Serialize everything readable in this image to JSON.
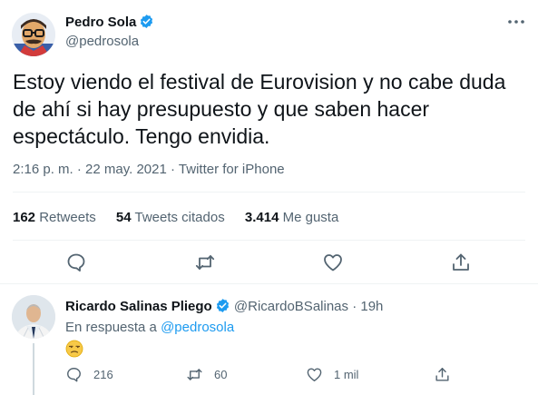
{
  "tweet": {
    "author_name": "Pedro Sola",
    "author_handle": "@pedrosola",
    "text": "Estoy viendo el festival de Eurovision y no cabe duda de ahí si hay presupuesto y que saben hacer espectáculo. Tengo envidia.",
    "time": "2:16 p. m.",
    "date": "22 may. 2021",
    "source": "Twitter for iPhone",
    "separator": "·",
    "retweets_count": "162",
    "retweets_label": "Retweets",
    "quotes_count": "54",
    "quotes_label": "Tweets citados",
    "likes_count": "3.414",
    "likes_label": "Me gusta"
  },
  "reply": {
    "author_name": "Ricardo Salinas Pliego",
    "author_handle": "@RicardoBSalinas",
    "separator": "·",
    "time_ago": "19h",
    "reply_prefix": "En respuesta a",
    "reply_to": "@pedrosola",
    "emoji": "😒",
    "replies_count": "216",
    "retweets_count": "60",
    "likes_count": "1 mil"
  },
  "icons": {
    "verified": "verified-badge-icon",
    "more": "more-icon",
    "reply": "reply-icon",
    "retweet": "retweet-icon",
    "like": "heart-icon",
    "share": "share-icon"
  },
  "colors": {
    "accent": "#1d9bf0",
    "text": "#0f1419",
    "secondary": "#536471",
    "divider": "#eff3f4"
  }
}
